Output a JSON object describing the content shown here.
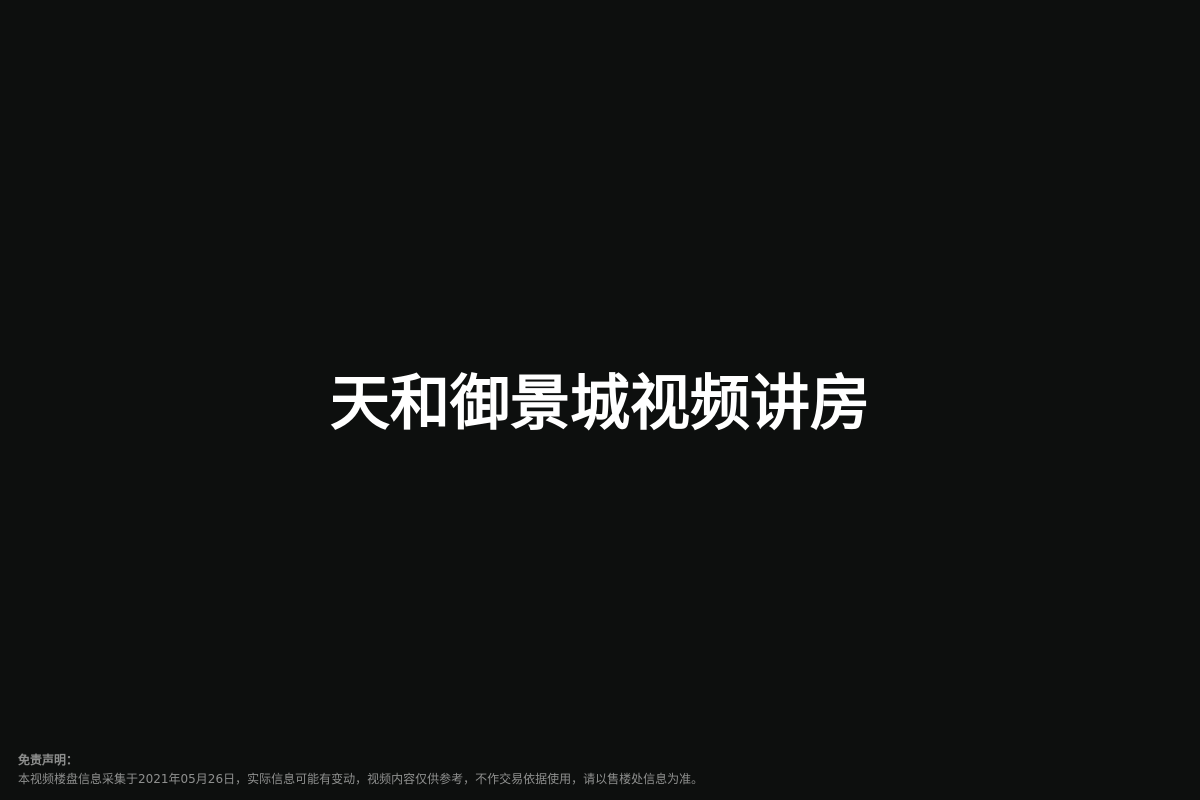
{
  "video": {
    "title": "天和御景城视频讲房"
  },
  "disclaimer": {
    "heading": "免责声明：",
    "body": "本视频楼盘信息采集于2021年05月26日，实际信息可能有变动，视频内容仅供参考，不作交易依据使用，请以售楼处信息为准。"
  },
  "colors": {
    "background": "#0d0f0e",
    "title": "#ffffff",
    "disclaimer": "#8e8f8e"
  }
}
